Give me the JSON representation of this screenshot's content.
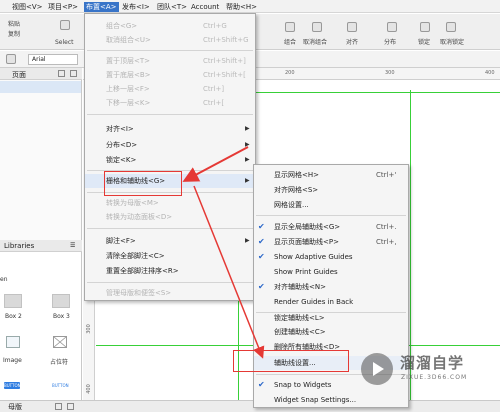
{
  "menubar": {
    "items": [
      {
        "label": "视图<V>"
      },
      {
        "label": "项目<P>"
      },
      {
        "label": "布置<A>"
      },
      {
        "label": "发布<I>"
      },
      {
        "label": "团队<T>"
      },
      {
        "label": "Account"
      },
      {
        "label": "帮助<H>"
      }
    ]
  },
  "toolbar": {
    "select_label": "Select",
    "left_labels": [
      "粘贴",
      "复制"
    ],
    "right_labels": [
      "组合",
      "取消组合",
      "对齐",
      "分布",
      "锁定",
      "取消锁定"
    ]
  },
  "formatbar": {
    "font": "Arial"
  },
  "pages_panel": {
    "title": "页面"
  },
  "libraries_panel": {
    "title": "Libraries",
    "section": "en",
    "widgets": [
      {
        "label": "Box 2"
      },
      {
        "label": "Box 3"
      },
      {
        "label": "Image"
      },
      {
        "label": "占位符"
      },
      {
        "label": "BUTTON"
      },
      {
        "label": "BUTTON"
      }
    ]
  },
  "bottom": {
    "label": "母版"
  },
  "ruler": {
    "top": [
      "200",
      "300",
      "400"
    ],
    "left": [
      "300",
      "400"
    ]
  },
  "arrange_menu": {
    "items": [
      {
        "label": "组合<G>",
        "shortcut": "Ctrl+G",
        "disabled": true
      },
      {
        "label": "取消组合<U>",
        "shortcut": "Ctrl+Shift+G",
        "disabled": true
      },
      {
        "label": "置于顶层<T>",
        "shortcut": "Ctrl+Shift+]",
        "disabled": true
      },
      {
        "label": "置于底层<B>",
        "shortcut": "Ctrl+Shift+[",
        "disabled": true
      },
      {
        "label": "上移一层<F>",
        "shortcut": "Ctrl+]",
        "disabled": true
      },
      {
        "label": "下移一层<K>",
        "shortcut": "Ctrl+[",
        "disabled": true
      },
      {
        "label": "对齐<I>",
        "arrow": true,
        "disabled": false
      },
      {
        "label": "分布<D>",
        "arrow": true,
        "disabled": false
      },
      {
        "label": "锁定<K>",
        "arrow": true,
        "disabled": false
      },
      {
        "label": "栅格和辅助线<G>",
        "arrow": true,
        "disabled": false
      },
      {
        "label": "转换为母版<M>",
        "disabled": true
      },
      {
        "label": "转换为动态面板<D>",
        "disabled": true
      },
      {
        "label": "脚注<F>",
        "arrow": true,
        "disabled": false
      },
      {
        "label": "清除全部脚注<C>",
        "disabled": false
      },
      {
        "label": "重置全部脚注排序<R>",
        "disabled": false
      },
      {
        "label": "管理母版和便签<S>",
        "disabled": true
      }
    ]
  },
  "grid_menu": {
    "items": [
      {
        "label": "显示网格<H>",
        "shortcut": "Ctrl+'",
        "checked": false
      },
      {
        "label": "对齐网格<S>",
        "shortcut": "",
        "checked": false
      },
      {
        "label": "网格设置...",
        "shortcut": "",
        "checked": false
      },
      {
        "label": "显示全局辅助线<G>",
        "shortcut": "Ctrl+.",
        "checked": true
      },
      {
        "label": "显示页面辅助线<P>",
        "shortcut": "Ctrl+,",
        "checked": true
      },
      {
        "label": "Show Adaptive Guides",
        "shortcut": "",
        "checked": true
      },
      {
        "label": "Show Print Guides",
        "shortcut": "",
        "checked": false
      },
      {
        "label": "对齐辅助线<N>",
        "shortcut": "",
        "checked": true
      },
      {
        "label": "Render Guides in Back",
        "shortcut": "",
        "checked": false
      },
      {
        "label": "锁定辅助线<L>",
        "shortcut": "",
        "checked": false
      },
      {
        "label": "创建辅助线<C>",
        "shortcut": "",
        "checked": false
      },
      {
        "label": "删除所有辅助线<D>",
        "shortcut": "",
        "checked": false
      },
      {
        "label": "辅助线设置...",
        "shortcut": "",
        "checked": false
      },
      {
        "label": "Snap to Widgets",
        "shortcut": "",
        "checked": true
      },
      {
        "label": "Widget Snap Settings...",
        "shortcut": "",
        "checked": false
      }
    ]
  },
  "watermark": {
    "title": "溜溜自学",
    "url": "ZIXUE.3D66.COM"
  },
  "colors": {
    "highlight": "#e53935",
    "guide": "#38d038",
    "menu_active": "#3874c8"
  }
}
